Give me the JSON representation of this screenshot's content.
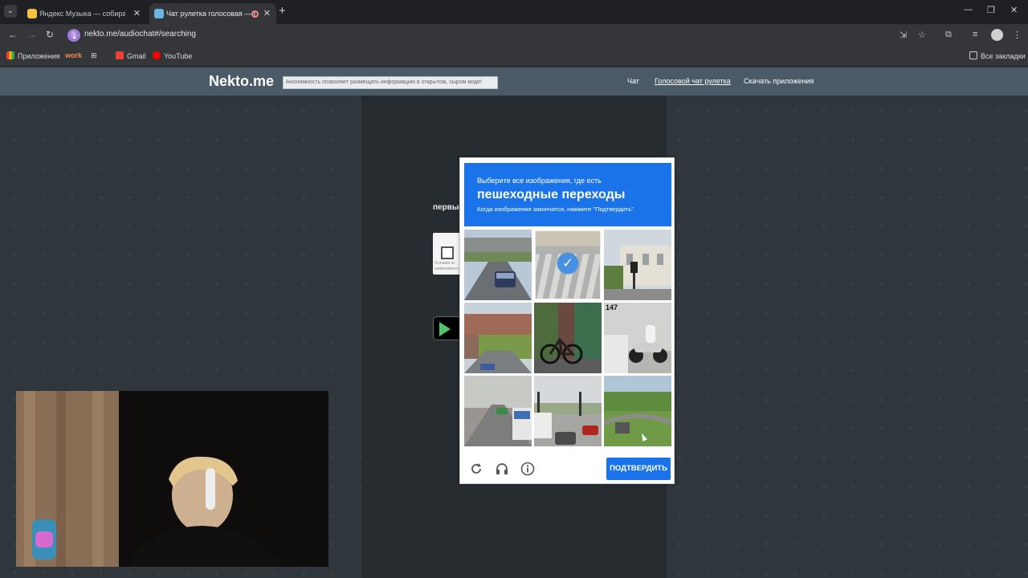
{
  "browser": {
    "tabs": [
      {
        "title": "Яндекс Музыка — собираем м",
        "active": false,
        "icon": "yandex-music-icon"
      },
      {
        "title": "Чат рулетка голосовая — Н",
        "active": true,
        "icon": "nekto-icon"
      }
    ],
    "url": "nekto.me/audiochat#/searching",
    "bookmarks": [
      {
        "label": "Приложения",
        "icon": "apps-grid-icon"
      },
      {
        "label": "work",
        "icon": ""
      },
      {
        "label": "",
        "icon": "grid-icon"
      },
      {
        "label": "Gmail",
        "icon": "gmail-icon"
      },
      {
        "label": "YouTube",
        "icon": "youtube-icon"
      }
    ],
    "all_bookmarks": "Все закладки"
  },
  "site": {
    "logo": "Nekto.me",
    "banner": "Анонимность позволяет размещать информацию в открытом, сыром виде!",
    "nav": [
      "Чат",
      "Голосовой чат рулетка",
      "Скачать приложения"
    ],
    "under_text": "первые",
    "under_small": "Условия ис изменяемост"
  },
  "captcha": {
    "instruction": "Выберите все изображения, где есть",
    "target": "пешеходные переходы",
    "hint": "Когда изображения закончатся, нажмите \"Подтвердить\".",
    "tiles": [
      {
        "scene": "overpass-road-car",
        "selected": false
      },
      {
        "scene": "crosswalk-road",
        "selected": true
      },
      {
        "scene": "building-traffic-light",
        "selected": false
      },
      {
        "scene": "bridge-road-car",
        "selected": false
      },
      {
        "scene": "bicycle-wall",
        "selected": false
      },
      {
        "scene": "motorcycle-street",
        "label": "147",
        "selected": false
      },
      {
        "scene": "highway-bus",
        "selected": false
      },
      {
        "scene": "intersection-cars",
        "selected": false
      },
      {
        "scene": "green-field-bridge",
        "selected": false
      }
    ],
    "verify": "ПОДТВЕРДИТЬ",
    "icons": [
      "reload-icon",
      "audio-headphones-icon",
      "info-icon"
    ]
  },
  "colors": {
    "captcha_blue": "#1a73e8",
    "header_bg": "#4a5a66"
  }
}
